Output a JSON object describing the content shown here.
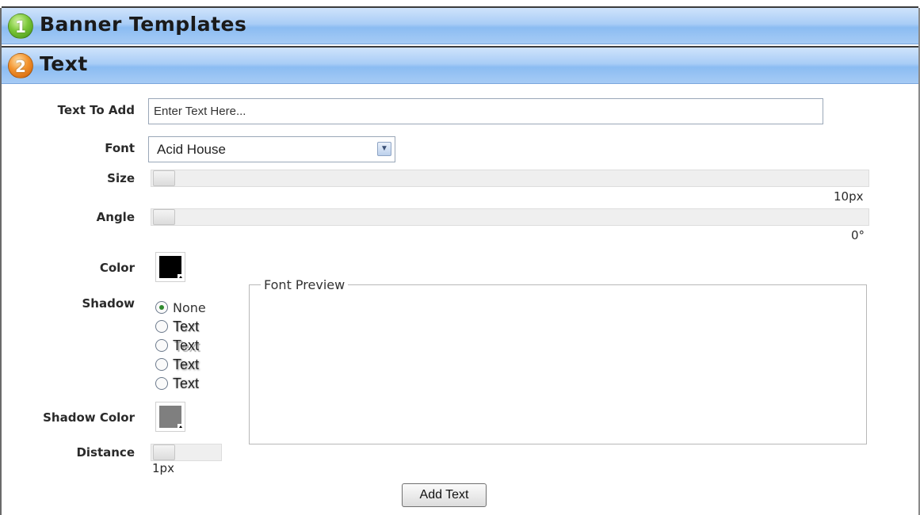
{
  "sections": [
    {
      "number": "1",
      "title": "Banner Templates",
      "color": "#6cbc2e"
    },
    {
      "number": "2",
      "title": "Text",
      "color": "#ee8a22"
    }
  ],
  "form": {
    "text_label": "Text To Add",
    "text_value": "Enter Text Here...",
    "font_label": "Font",
    "font_selected": "Acid House",
    "size_label": "Size",
    "size_value": "10px",
    "angle_label": "Angle",
    "angle_value": "0°",
    "color_label": "Color",
    "color_value": "#000000",
    "shadow_label": "Shadow",
    "shadow_options": [
      "None",
      "Text",
      "Text",
      "Text",
      "Text"
    ],
    "shadow_selected": "None",
    "shadow_color_label": "Shadow Color",
    "shadow_color_value": "#7f7f7f",
    "distance_label": "Distance",
    "distance_value": "1px"
  },
  "preview": {
    "legend": "Font Preview"
  },
  "actions": {
    "add_text_label": "Add Text"
  }
}
